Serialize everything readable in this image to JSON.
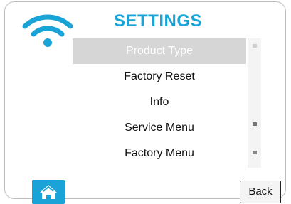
{
  "header": {
    "title": "SETTINGS",
    "wifi_icon": "wifi-icon"
  },
  "menu": {
    "items": [
      {
        "label": "Product Type",
        "selected": true
      },
      {
        "label": "Factory Reset",
        "selected": false
      },
      {
        "label": "Info",
        "selected": false
      },
      {
        "label": "Service Menu",
        "selected": false
      },
      {
        "label": "Factory Menu",
        "selected": false
      }
    ]
  },
  "footer": {
    "home_icon": "home-icon",
    "back_label": "Back"
  },
  "colors": {
    "accent": "#1aa3d6",
    "selected_bg": "#d6d6d6"
  }
}
